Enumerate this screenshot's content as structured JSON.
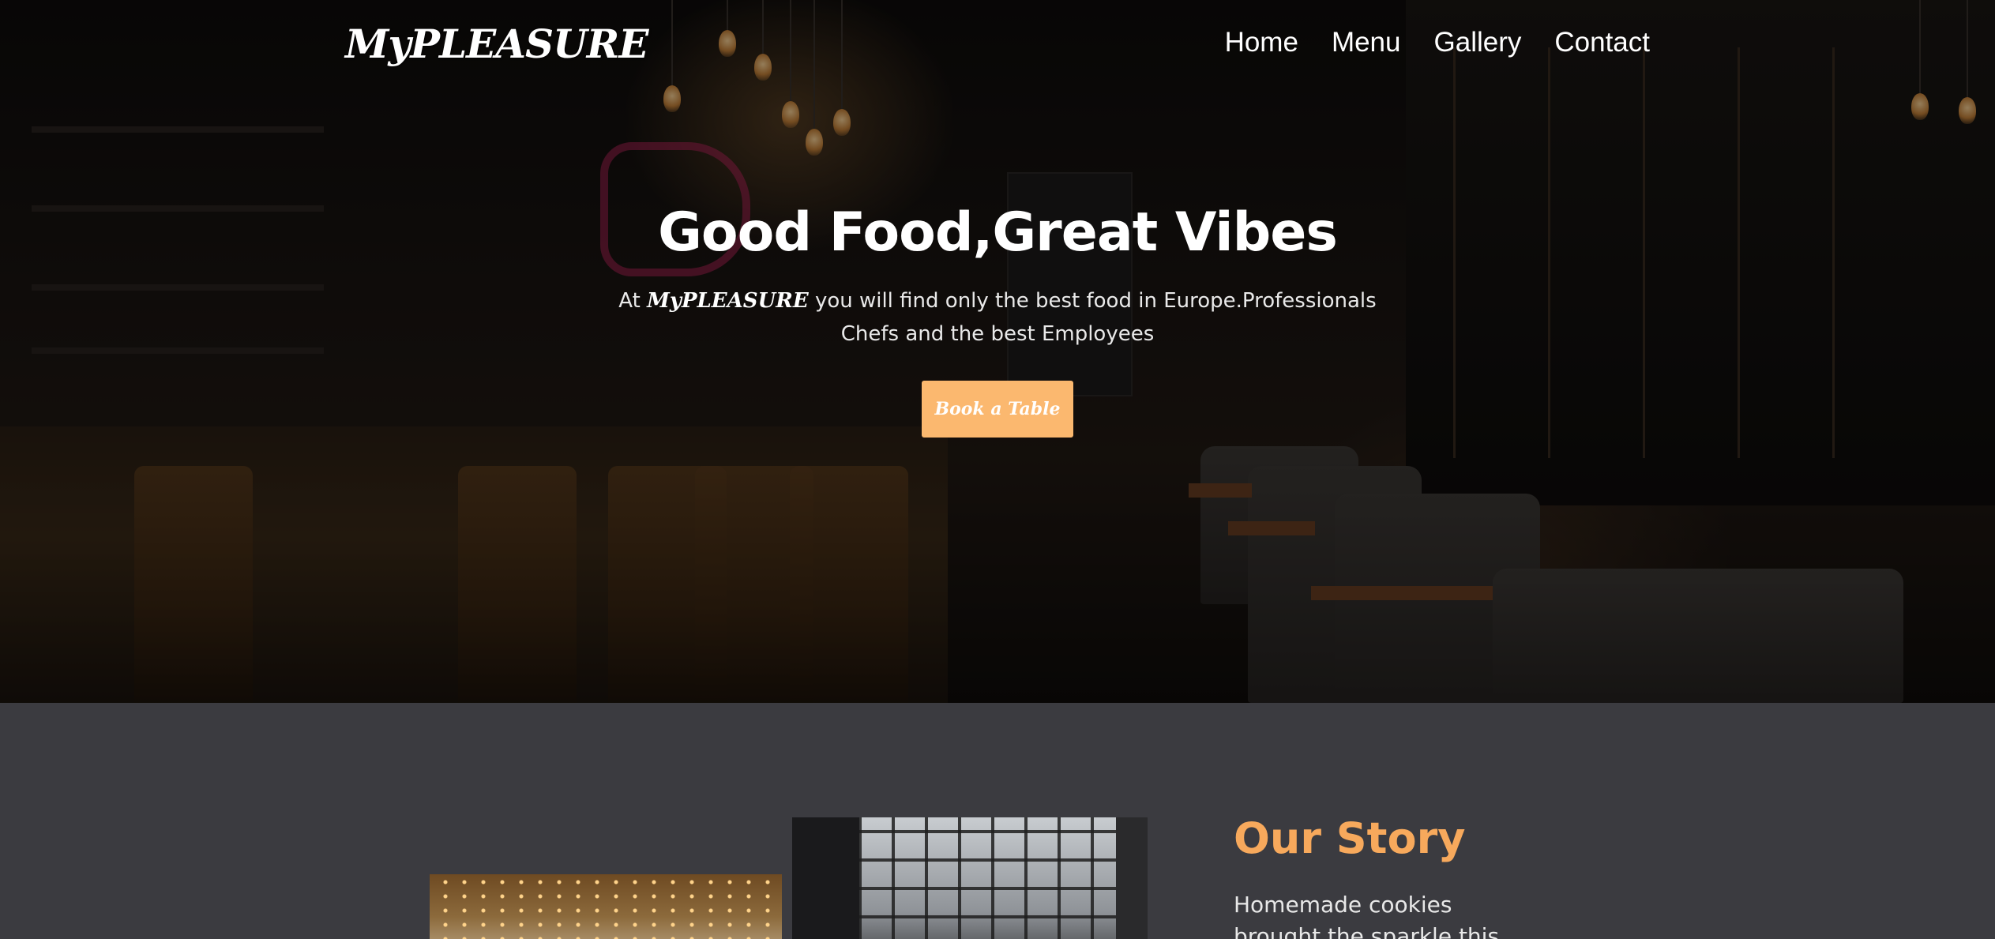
{
  "header": {
    "logo": "MyPLEASURE",
    "nav": [
      "Home",
      "Menu",
      "Gallery",
      "Contact"
    ]
  },
  "hero": {
    "title": "Good Food,Great Vibes",
    "subtitle_prefix": "At",
    "subtitle_brand": "MyPLEASURE",
    "subtitle_rest": "you will find only the best food in Europe.Professionals Chefs and the best Employees",
    "cta_label": "Book a Table"
  },
  "story": {
    "title": "Our Story",
    "text": "Homemade cookies brought the sparkle this holiday"
  },
  "colors": {
    "accent": "#fbb86f",
    "story_title": "#f7a95c",
    "section_bg": "#3b3b40"
  }
}
